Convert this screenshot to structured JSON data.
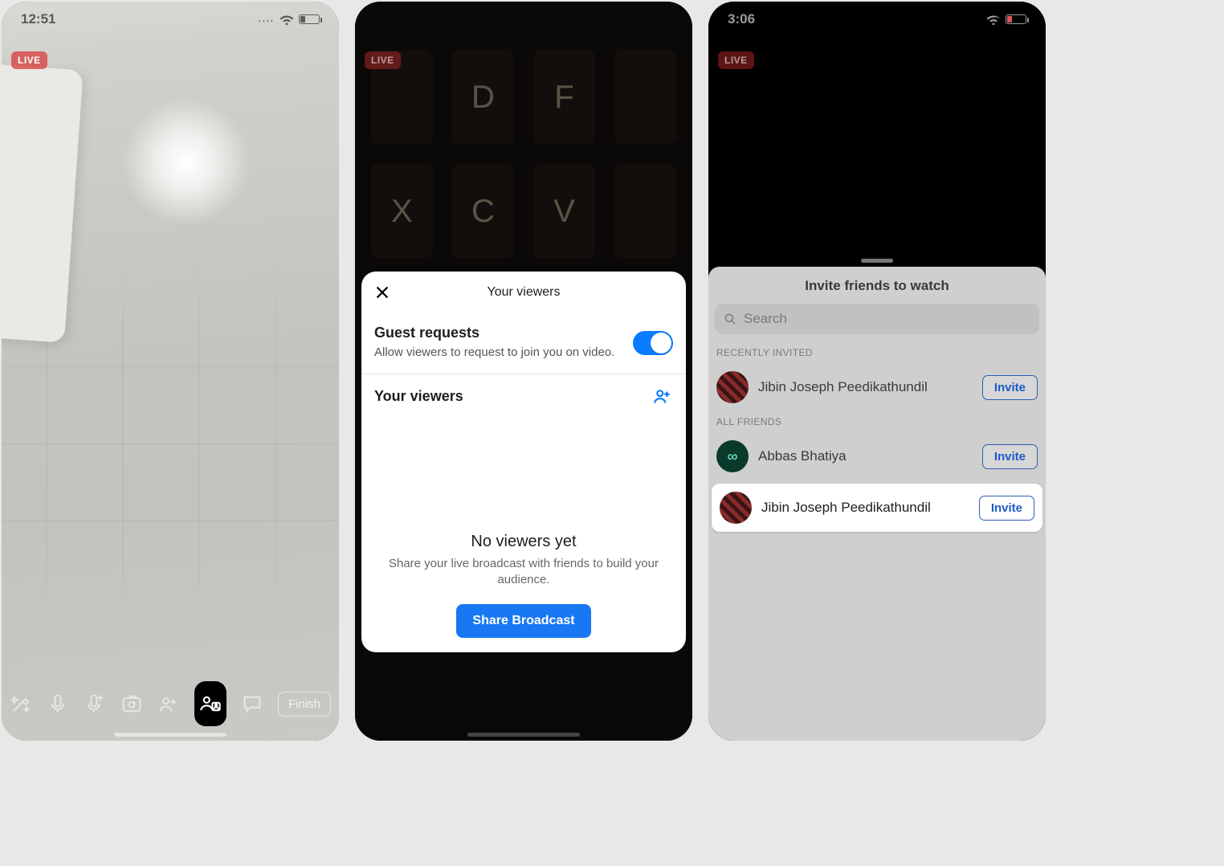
{
  "screen1": {
    "time": "12:51",
    "live_badge": "LIVE",
    "finish_label": "Finish"
  },
  "screen2": {
    "live_badge": "LIVE",
    "sheet": {
      "title": "Your viewers",
      "guest_section_title": "Guest requests",
      "guest_section_desc": "Allow viewers to request to join you on video.",
      "viewers_section_title": "Your viewers",
      "empty_title": "No viewers yet",
      "empty_desc": "Share your live broadcast with friends to build your audience.",
      "share_button": "Share Broadcast",
      "toggle_on": true
    }
  },
  "screen3": {
    "time": "3:06",
    "live_badge": "LIVE",
    "panel_title": "Invite friends to watch",
    "search_placeholder": "Search",
    "section_recent": "RECENTLY INVITED",
    "section_all": "ALL FRIENDS",
    "invite_label": "Invite",
    "friends": {
      "recent": [
        {
          "name": "Jibin Joseph Peedikathundil"
        }
      ],
      "all": [
        {
          "name": "Abbas Bhatiya"
        },
        {
          "name": "Jibin Joseph Peedikathundil"
        }
      ]
    }
  }
}
